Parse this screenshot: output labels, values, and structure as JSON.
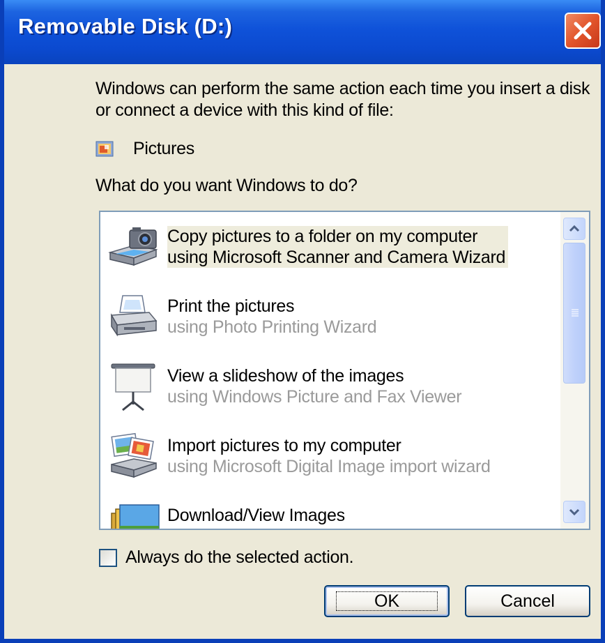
{
  "window": {
    "title": "Removable Disk (D:)",
    "colors": {
      "title_bar": "#0b4ad0",
      "window_frame": "#0a3fb8",
      "dialog_face": "#ece9d8",
      "close_button": "#e2552b",
      "listbox_border": "#7f9db9",
      "button_border": "#003c74",
      "secondary_text": "#9a9a9a",
      "selected_item_highlight": "#eeecdc"
    }
  },
  "dialog": {
    "intro": "Windows can perform the same action each time you insert a disk or connect a device with this kind of file:",
    "content_type": {
      "icon": "pictures-folder-icon",
      "label": "Pictures"
    },
    "question": "What do you want Windows to do?",
    "actions": [
      {
        "icon": "scanner-camera-icon",
        "title": "Copy pictures to a folder on my computer",
        "subtitle": "using Microsoft Scanner and Camera Wizard",
        "selected": true
      },
      {
        "icon": "printer-icon",
        "title": "Print the pictures",
        "subtitle": "using Photo Printing Wizard",
        "selected": false
      },
      {
        "icon": "projector-screen-icon",
        "title": "View a slideshow of the images",
        "subtitle": "using Windows Picture and Fax Viewer",
        "selected": false
      },
      {
        "icon": "import-pictures-icon",
        "title": "Import pictures to my computer",
        "subtitle": "using Microsoft Digital Image import wizard",
        "selected": false
      },
      {
        "icon": "image-stack-icon",
        "title": "Download/View Images",
        "subtitle": "",
        "selected": false
      }
    ],
    "always_checkbox": {
      "label": "Always do the selected action.",
      "checked": false
    },
    "buttons": {
      "ok": "OK",
      "cancel": "Cancel"
    }
  }
}
